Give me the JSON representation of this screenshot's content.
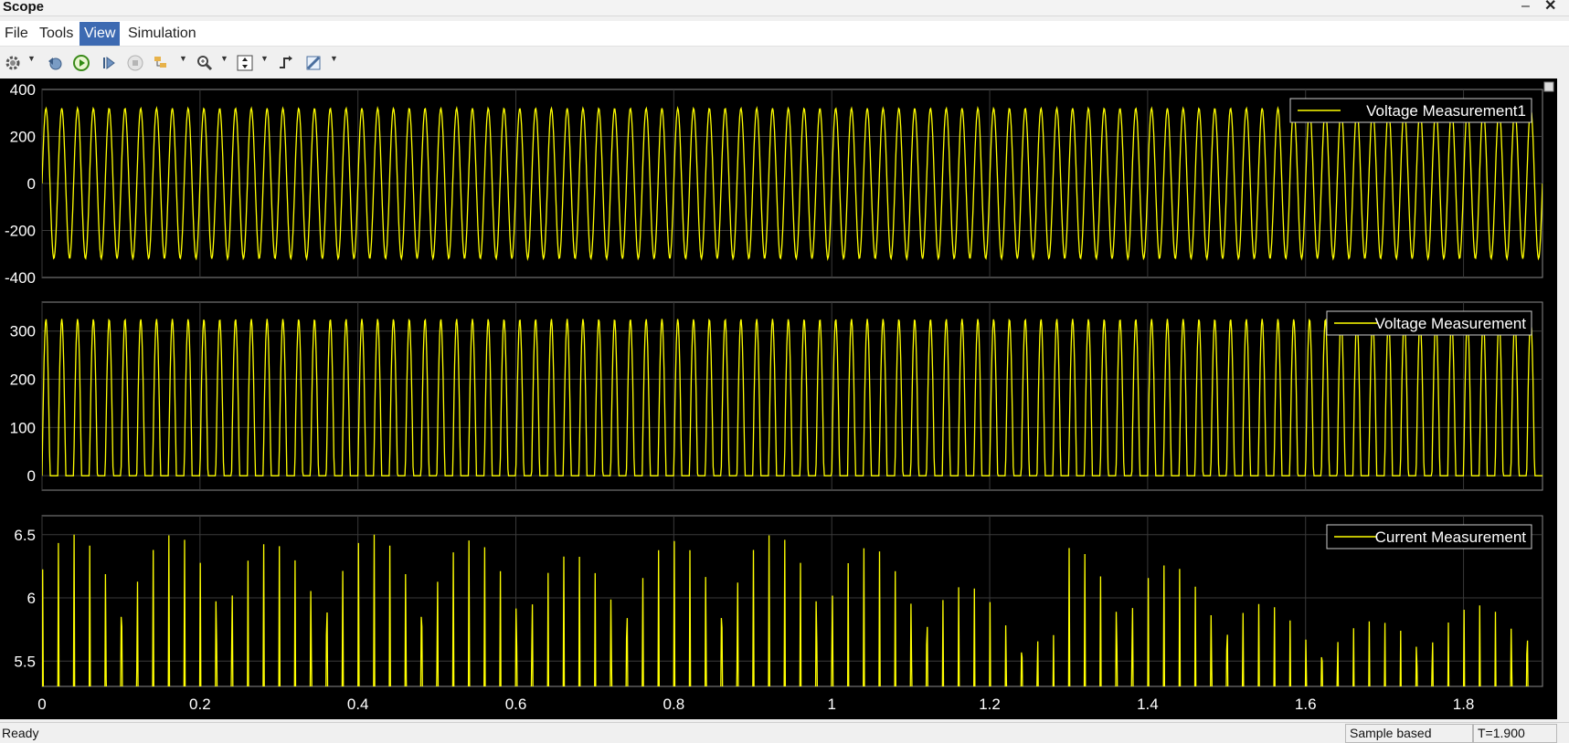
{
  "window": {
    "title": "Scope",
    "minimize_glyph": "–",
    "close_glyph": "✕"
  },
  "menu": [
    {
      "label": "File"
    },
    {
      "label": "Tools"
    },
    {
      "label": "View",
      "active": true
    },
    {
      "label": "Simulation"
    }
  ],
  "toolbar": [
    {
      "icon": "settings-gear-icon",
      "dropdown": true
    },
    {
      "icon": "restore-config-icon"
    },
    {
      "icon": "run-icon"
    },
    {
      "icon": "step-forward-icon"
    },
    {
      "icon": "stop-icon"
    },
    {
      "icon": "highlight-signal-icon",
      "dropdown": true
    },
    {
      "icon": "zoom-icon",
      "dropdown": true
    },
    {
      "icon": "scale-axes-icon",
      "dropdown": true
    },
    {
      "icon": "triggers-icon"
    },
    {
      "icon": "measurements-icon",
      "dropdown": true
    }
  ],
  "status": {
    "ready": "Ready",
    "mode": "Sample based",
    "time": "T=1.900"
  },
  "colors": {
    "background": "#000000",
    "trace": "#ffff00",
    "grid": "#3a3a3a",
    "axes_text": "#ffffff",
    "active_menu": "#3d6ab2"
  },
  "chart_data": [
    {
      "type": "line",
      "legend": "Voltage Measurement1",
      "legend_placement": "top-right",
      "ylim": [
        -400,
        400
      ],
      "yticks": [
        "400",
        "200",
        "0",
        "-200",
        "-400"
      ],
      "xlim": [
        0,
        1.9
      ],
      "xticks": [
        "0",
        "0.2",
        "0.4",
        "0.6",
        "0.8",
        "1",
        "1.2",
        "1.4",
        "1.6",
        "1.8"
      ],
      "grid": true,
      "signal": {
        "waveform": "sine",
        "frequency_hz": 50,
        "amplitude": 320
      }
    },
    {
      "type": "line",
      "legend": "Voltage Measurement",
      "legend_placement": "top-right",
      "ylim": [
        -30,
        360
      ],
      "yticks": [
        "300",
        "200",
        "100",
        "0"
      ],
      "xlim": [
        0,
        1.9
      ],
      "xticks": [
        "0",
        "0.2",
        "0.4",
        "0.6",
        "0.8",
        "1",
        "1.2",
        "1.4",
        "1.6",
        "1.8"
      ],
      "grid": true,
      "signal": {
        "waveform": "clipped-sine",
        "frequency_hz": 50,
        "amplitude": 325,
        "floor": 0
      }
    },
    {
      "type": "line",
      "legend": "Current Measurement",
      "legend_placement": "top-right",
      "ylim": [
        5.3,
        6.65
      ],
      "yticks": [
        "6.5",
        "6",
        "5.5"
      ],
      "xlim": [
        0,
        1.9
      ],
      "xticks": [
        "0",
        "0.2",
        "0.4",
        "0.6",
        "0.8",
        "1",
        "1.2",
        "1.4",
        "1.6",
        "1.8"
      ],
      "xtick_values": [
        0,
        0.2,
        0.4,
        0.6,
        0.8,
        1,
        1.2,
        1.4,
        1.6,
        1.8
      ],
      "grid": true,
      "signal": {
        "waveform": "pulses",
        "frequency_hz": 50,
        "baseline": 5.3
      },
      "peak_envelope": [
        {
          "t": 0.0,
          "peak": 6.5
        },
        {
          "t": 0.25,
          "peak": 6.5
        },
        {
          "t": 0.3,
          "peak": 6.42
        },
        {
          "t": 0.4,
          "peak": 6.5
        },
        {
          "t": 0.5,
          "peak": 6.5
        },
        {
          "t": 0.6,
          "peak": 6.4
        },
        {
          "t": 0.7,
          "peak": 6.32
        },
        {
          "t": 0.78,
          "peak": 6.44
        },
        {
          "t": 0.9,
          "peak": 6.5
        },
        {
          "t": 1.0,
          "peak": 6.5
        },
        {
          "t": 1.1,
          "peak": 6.3
        },
        {
          "t": 1.2,
          "peak": 6.02
        },
        {
          "t": 1.29,
          "peak": 5.72
        },
        {
          "t": 1.3,
          "peak": 6.4
        },
        {
          "t": 1.4,
          "peak": 6.32
        },
        {
          "t": 1.5,
          "peak": 6.12
        },
        {
          "t": 1.6,
          "peak": 5.8
        },
        {
          "t": 1.7,
          "peak": 5.82
        },
        {
          "t": 1.8,
          "peak": 5.92
        },
        {
          "t": 1.9,
          "peak": 6.05
        }
      ]
    }
  ]
}
